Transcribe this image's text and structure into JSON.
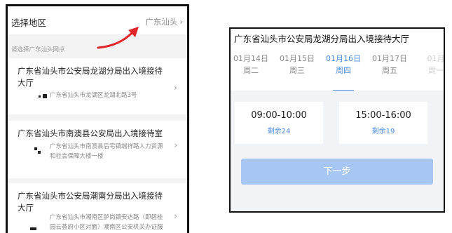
{
  "left": {
    "title": "选择地区",
    "region_value": "广东汕头",
    "region_chevron": "›",
    "hint": "请选择广东汕头网点",
    "cards": [
      {
        "title": "广东省汕头市公安局龙湖分局出入境接待大厅",
        "address": "广东省汕头市龙湖区龙湖北路3号",
        "chevron": "›"
      },
      {
        "title": "广东省汕头市南澳县公安局出入境接待室",
        "address": "广东省汕头市南澳县后宅镇端祥路人力资源和社会保障大楼一楼",
        "chevron": "›"
      },
      {
        "title": "广东省汕头市公安局潮南分局出入境接待大厅",
        "address": "广东省汕头市潮南区胪岗镇安达路（即碧桂园云荟府小区对面）潮南区公安机关办证服务中心",
        "chevron": "›"
      }
    ]
  },
  "right": {
    "title": "广东省汕头市公安局龙湖分局出入境接待大厅",
    "dates": [
      {
        "date": "01月14日",
        "weekday": "周二"
      },
      {
        "date": "01月15日",
        "weekday": "周三"
      },
      {
        "date": "01月16日",
        "weekday": "周四"
      },
      {
        "date": "01月17日",
        "weekday": "周五"
      },
      {
        "date": "01月",
        "weekday": "周一"
      }
    ],
    "selected_date_index": 2,
    "slots": [
      {
        "time": "09:00-10:00",
        "remaining": "剩余24"
      },
      {
        "time": "15:00-16:00",
        "remaining": "剩余19"
      }
    ],
    "next_label": "下一步"
  },
  "colors": {
    "accent": "#4a8ae0",
    "button_disabled": "#a8c6f2",
    "annotation_arrow": "#e0242a"
  },
  "icons": {
    "region_chevron": "chevron-right-icon",
    "card_chevron": "chevron-right-icon",
    "arrow": "red-arrow-annotation-icon"
  }
}
